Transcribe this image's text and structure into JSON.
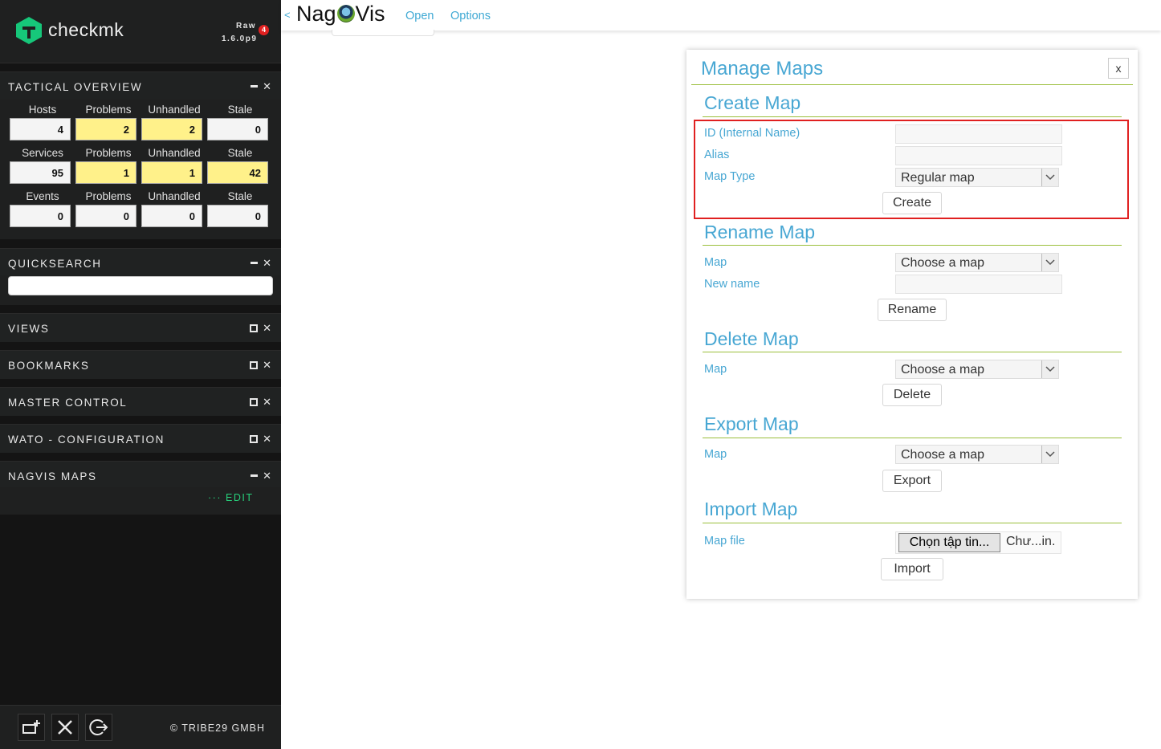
{
  "sidebar": {
    "brand": "checkmk",
    "edition": "Raw",
    "version": "1.6.0p9",
    "notification_count": "4",
    "tactical": {
      "title": "TACTICAL OVERVIEW",
      "rows": [
        {
          "labels": [
            "Hosts",
            "Problems",
            "Unhandled",
            "Stale"
          ],
          "values": [
            "4",
            "2",
            "2",
            "0"
          ]
        },
        {
          "labels": [
            "Services",
            "Problems",
            "Unhandled",
            "Stale"
          ],
          "values": [
            "95",
            "1",
            "1",
            "42"
          ]
        },
        {
          "labels": [
            "Events",
            "Problems",
            "Unhandled",
            "Stale"
          ],
          "values": [
            "0",
            "0",
            "0",
            "0"
          ]
        }
      ]
    },
    "quicksearch": {
      "title": "QUICKSEARCH"
    },
    "views": {
      "title": "VIEWS"
    },
    "bookmarks": {
      "title": "BOOKMARKS"
    },
    "master_control": {
      "title": "MASTER CONTROL"
    },
    "wato": {
      "title": "WATO - CONFIGURATION"
    },
    "nagvis_maps": {
      "title": "NAGVIS MAPS",
      "edit_label": "EDIT",
      "edit_dots": "···"
    },
    "footer": {
      "copyright": "© TRIBE29 GMBH"
    }
  },
  "topbar": {
    "back": "<",
    "logo_left": "Nag",
    "logo_right": "Vis",
    "menu": [
      "Open",
      "Options"
    ]
  },
  "dialog": {
    "title": "Manage Maps",
    "close": "x",
    "create": {
      "title": "Create Map",
      "id_label": "ID (Internal Name)",
      "alias_label": "Alias",
      "type_label": "Map Type",
      "type_value": "Regular map",
      "button": "Create"
    },
    "rename": {
      "title": "Rename Map",
      "map_label": "Map",
      "map_value": "Choose a map",
      "newname_label": "New name",
      "button": "Rename"
    },
    "delete": {
      "title": "Delete Map",
      "map_label": "Map",
      "map_value": "Choose a map",
      "button": "Delete"
    },
    "export": {
      "title": "Export Map",
      "map_label": "Map",
      "map_value": "Choose a map",
      "button": "Export"
    },
    "import": {
      "title": "Import Map",
      "file_label": "Map file",
      "file_button": "Chọn tập tin...",
      "file_name": "Chư...in.",
      "button": "Import"
    }
  },
  "colors": {
    "highlight": "#e02020",
    "accent": "#48a7d3",
    "warn": "#fff18a"
  }
}
